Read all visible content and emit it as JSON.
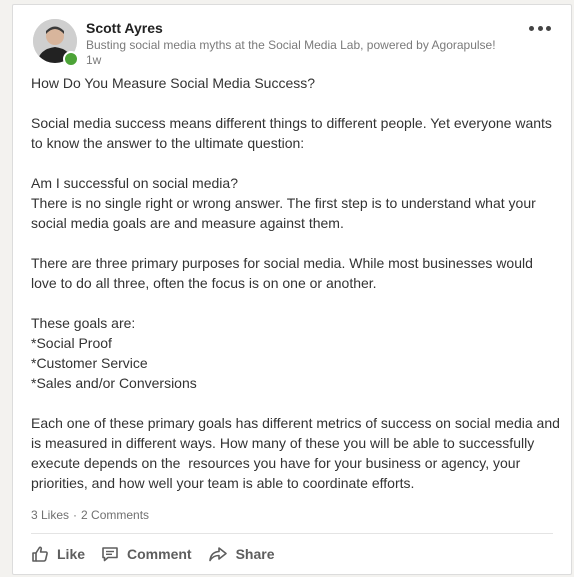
{
  "post": {
    "author": {
      "name": "Scott Ayres",
      "headline": "Busting social media myths at the Social Media Lab, powered by Agorapulse!",
      "time": "1w"
    },
    "body_text": "How Do You Measure Social Media Success?\n\nSocial media success means different things to different people. Yet everyone wants to know the answer to the ultimate question:\n\nAm I successful on social media?\nThere is no single right or wrong answer. The first step is to understand what your social media goals are and measure against them.\n\nThere are three primary purposes for social media. While most businesses would love to do all three, often the focus is on one or another.\n\nThese goals are:\n*Social Proof\n*Customer Service\n*Sales and/or Conversions\n\nEach one of these primary goals has different metrics of success on social media and is measured in different ways. How many of these you will be able to successfully execute depends on the  resources you have for your business or agency, your priorities, and how well your team is able to coordinate efforts.",
    "social_counts": {
      "likes": "3 Likes",
      "separator": "·",
      "comments": "2 Comments"
    },
    "actions": {
      "like": "Like",
      "comment": "Comment",
      "share": "Share"
    },
    "icons": {
      "more": "more-options-icon",
      "like": "thumbs-up-icon",
      "comment": "comment-icon",
      "share": "share-arrow-icon"
    },
    "colors": {
      "presence": "#4ca337",
      "action_text": "#5e5e5e",
      "meta_text": "#7a7a7a"
    }
  }
}
